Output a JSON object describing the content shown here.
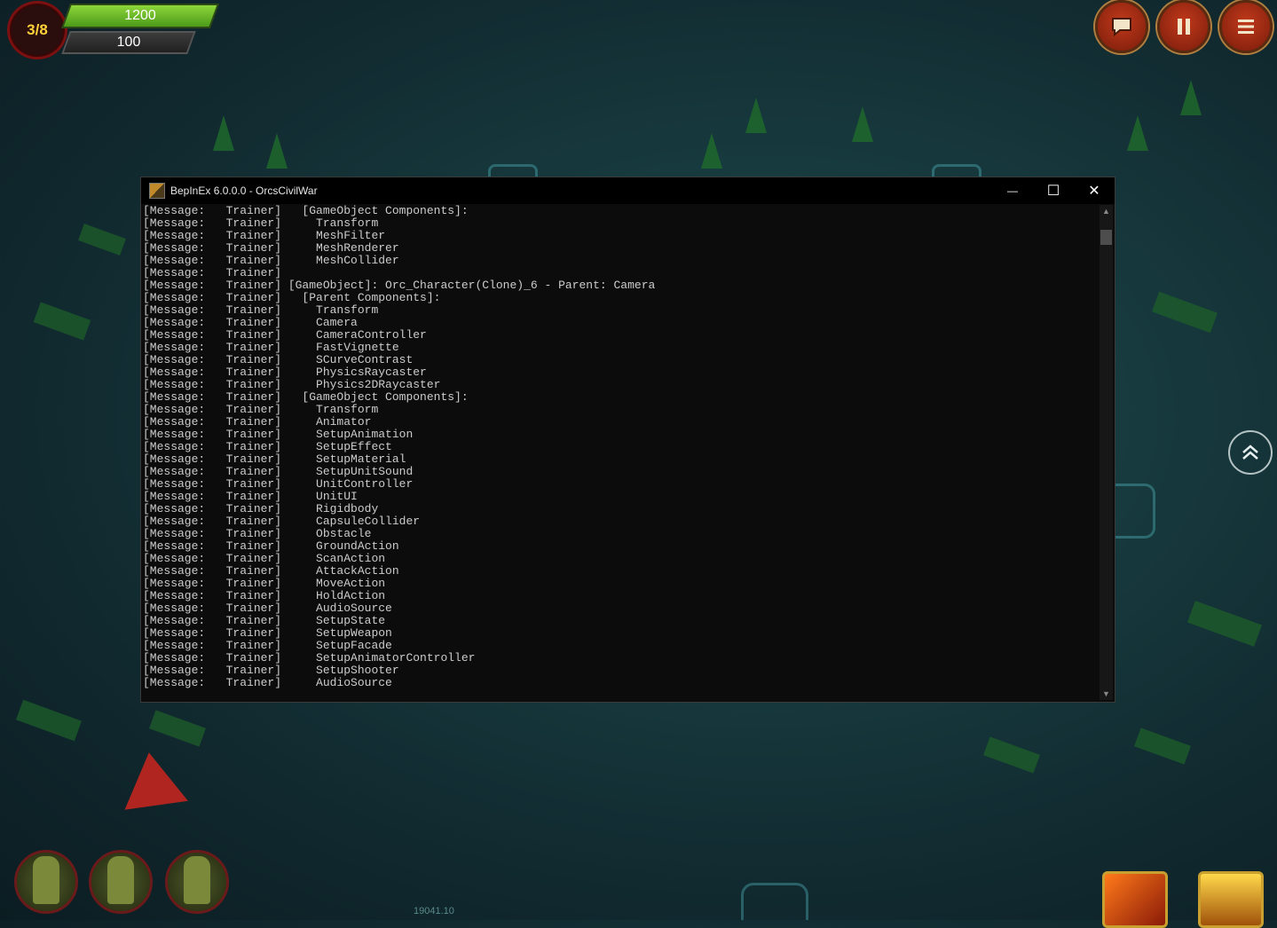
{
  "hud": {
    "wave": "3/8",
    "health": "1200",
    "gold": "100",
    "chat_icon": "chat-icon",
    "pause_icon": "pause-icon",
    "menu_icon": "menu-icon",
    "version": "19041.10"
  },
  "console": {
    "title": "BepInEx 6.0.0.0 - OrcsCivilWar",
    "minimize": "—",
    "maximize": "☐",
    "close": "✕",
    "lines": [
      "[Message:   Trainer]   [GameObject Components]:",
      "[Message:   Trainer]     Transform",
      "[Message:   Trainer]     MeshFilter",
      "[Message:   Trainer]     MeshRenderer",
      "[Message:   Trainer]     MeshCollider",
      "[Message:   Trainer]",
      "[Message:   Trainer] [GameObject]: Orc_Character(Clone)_6 - Parent: Camera",
      "[Message:   Trainer]   [Parent Components]:",
      "[Message:   Trainer]     Transform",
      "[Message:   Trainer]     Camera",
      "[Message:   Trainer]     CameraController",
      "[Message:   Trainer]     FastVignette",
      "[Message:   Trainer]     SCurveContrast",
      "[Message:   Trainer]     PhysicsRaycaster",
      "[Message:   Trainer]     Physics2DRaycaster",
      "[Message:   Trainer]   [GameObject Components]:",
      "[Message:   Trainer]     Transform",
      "[Message:   Trainer]     Animator",
      "[Message:   Trainer]     SetupAnimation",
      "[Message:   Trainer]     SetupEffect",
      "[Message:   Trainer]     SetupMaterial",
      "[Message:   Trainer]     SetupUnitSound",
      "[Message:   Trainer]     UnitController",
      "[Message:   Trainer]     UnitUI",
      "[Message:   Trainer]     Rigidbody",
      "[Message:   Trainer]     CapsuleCollider",
      "[Message:   Trainer]     Obstacle",
      "[Message:   Trainer]     GroundAction",
      "[Message:   Trainer]     ScanAction",
      "[Message:   Trainer]     AttackAction",
      "[Message:   Trainer]     MoveAction",
      "[Message:   Trainer]     HoldAction",
      "[Message:   Trainer]     AudioSource",
      "[Message:   Trainer]     SetupState",
      "[Message:   Trainer]     SetupWeapon",
      "[Message:   Trainer]     SetupFacade",
      "[Message:   Trainer]     SetupAnimatorController",
      "[Message:   Trainer]     SetupShooter",
      "[Message:   Trainer]     AudioSource"
    ]
  }
}
